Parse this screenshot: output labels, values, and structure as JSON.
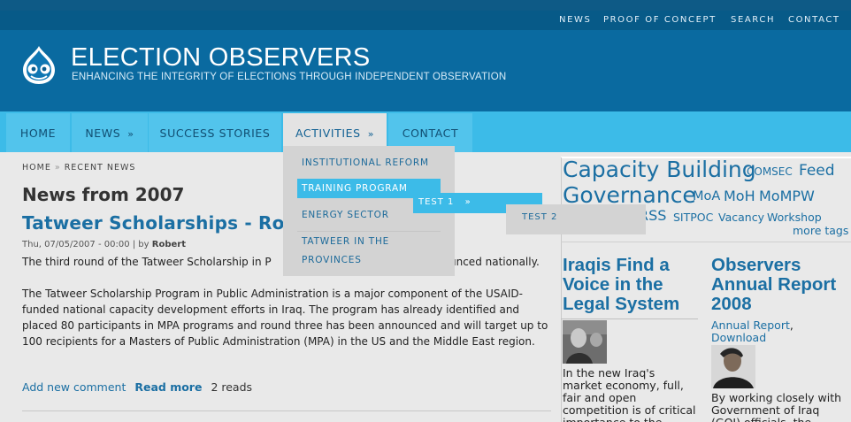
{
  "topnav": {
    "items": [
      "NEWS",
      "PROOF OF CONCEPT",
      "SEARCH",
      "CONTACT"
    ]
  },
  "header": {
    "site_name": "ELECTION OBSERVERS",
    "slogan": "ENHANCING THE INTEGRITY OF ELECTIONS THROUGH INDEPENDENT OBSERVATION",
    "logo_icon": "drupal-drop-icon"
  },
  "mainnav": {
    "home": "HOME",
    "news": "NEWS",
    "success": "SUCCESS STORIES",
    "activities": "ACTIVITIES",
    "contact": "CONTACT",
    "arrow": "»"
  },
  "dropdown": {
    "items": [
      "INSTITUTIONAL REFORM",
      "TRAINING PROGRAM",
      "ENERGY SECTOR",
      "TATWEER IN THE",
      "PROVINCES"
    ],
    "sub1": "TEST 1",
    "sub2": "TEST 2"
  },
  "breadcrumb": {
    "home": "HOME",
    "sep": "»",
    "current": "RECENT NEWS"
  },
  "page": {
    "title": "News from 2007"
  },
  "node": {
    "title": "Tatweer Scholarships - Roun",
    "date": "Thu, 07/05/2007 - 00:00",
    "by": "| by",
    "author": "Robert",
    "para1_a": "The third round of the Tatweer Scholarship in P",
    "para1_b": "unced nationally.",
    "para2": "The Tatweer Scholarship Program in Public Administration is a major component of the USAID-funded national capacity development efforts in Iraq. The program has already identified and placed 80 participants in MPA programs and round three has been announced and will target up to 100 recipients for a Masters of Public Administration (MPA) in the US and the Middle East region.",
    "add_comment": "Add new comment",
    "read_more": "Read more",
    "reads": "2 reads"
  },
  "tags": {
    "capacity_building": "Capacity Building",
    "comsec": "COMSEC",
    "feed": "Feed",
    "governance": "Governance",
    "moa": "MoA",
    "moh": "MoH",
    "mompw": "MoMPW",
    "rss": "RSS",
    "sitpoc": "SITPOC",
    "vacancy": "Vacancy",
    "workshop": "Workshop",
    "more_tags": "more tags"
  },
  "side": {
    "story1_title": "Iraqis Find a Voice in the Legal System",
    "story1_text": "In the new Iraq's market economy, full, fair and open competition is of critical importance to the",
    "story2_title": "Observers Annual Report 2008",
    "story2_link1": "Annual Report",
    "story2_comma": ",",
    "story2_link2": "Download",
    "story2_text": "By working closely with Government of Iraq (GOI) officials, the"
  },
  "colors": {
    "top_bar": "#075a88",
    "header": "#0a6aa0",
    "nav": "#3cbbe8",
    "link": "#1b6fa3"
  }
}
